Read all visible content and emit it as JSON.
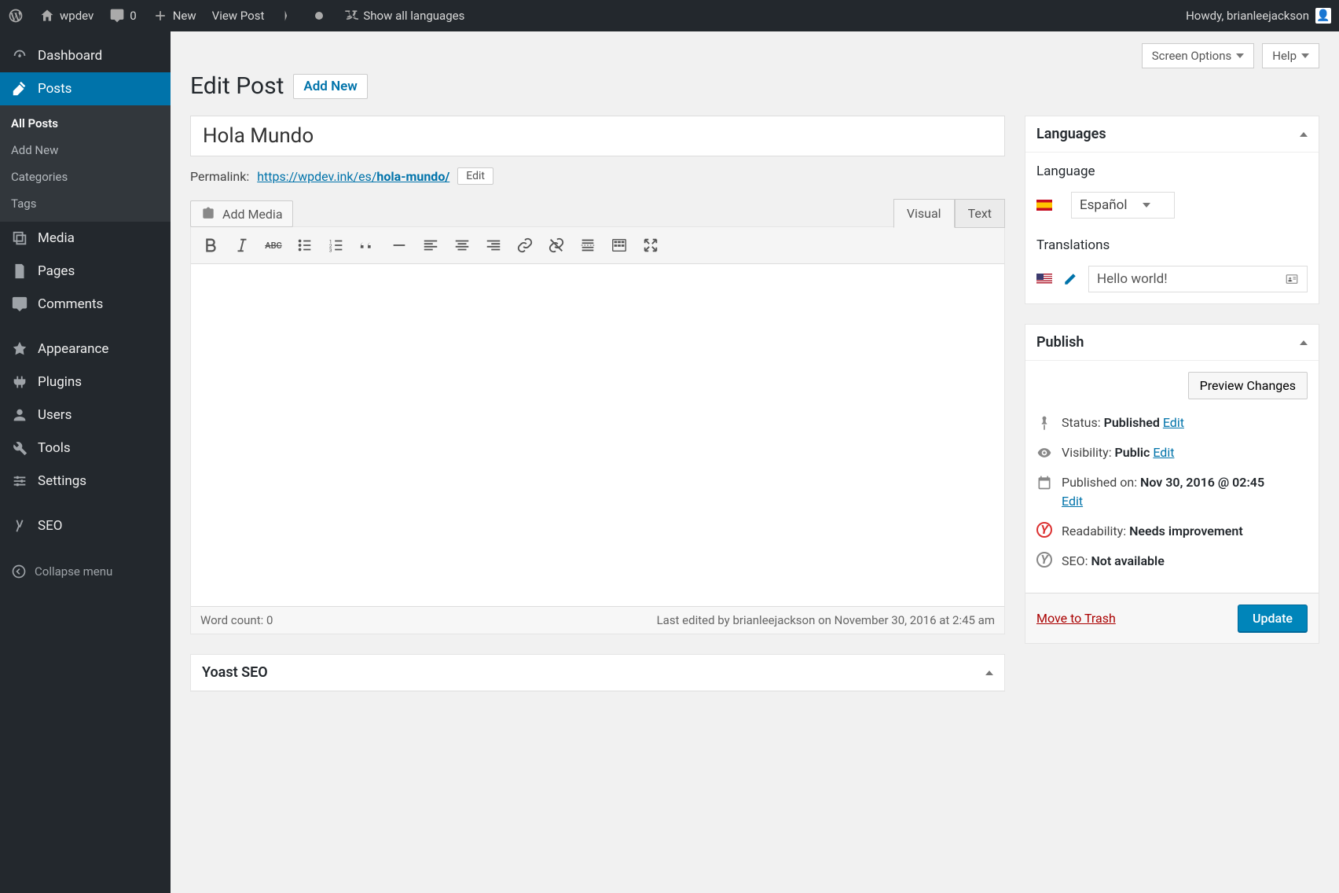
{
  "toolbar": {
    "site_name": "wpdev",
    "comments_count": "0",
    "new_label": "New",
    "view_post": "View Post",
    "show_languages": "Show all languages",
    "howdy": "Howdy, brianleejackson"
  },
  "sidebar": {
    "dashboard": "Dashboard",
    "posts": "Posts",
    "sub_all": "All Posts",
    "sub_add": "Add New",
    "sub_cat": "Categories",
    "sub_tags": "Tags",
    "media": "Media",
    "pages": "Pages",
    "comments": "Comments",
    "appearance": "Appearance",
    "plugins": "Plugins",
    "users": "Users",
    "tools": "Tools",
    "settings": "Settings",
    "seo": "SEO",
    "collapse": "Collapse menu"
  },
  "top": {
    "screen_options": "Screen Options",
    "help": "Help"
  },
  "page": {
    "title": "Edit Post",
    "add_new": "Add New"
  },
  "post": {
    "title": "Hola Mundo",
    "permalink_label": "Permalink:",
    "permalink_base": "https://wpdev.ink/es/",
    "permalink_slug": "hola-mundo/",
    "edit": "Edit",
    "add_media": "Add Media",
    "tab_visual": "Visual",
    "tab_text": "Text",
    "word_count": "Word count: 0",
    "last_edit": "Last edited by brianleejackson on November 30, 2016 at 2:45 am"
  },
  "yoast": {
    "title": "Yoast SEO"
  },
  "lang_box": {
    "title": "Languages",
    "label": "Language",
    "selected": "Español",
    "trans_label": "Translations",
    "trans_value": "Hello world!"
  },
  "publish": {
    "title": "Publish",
    "preview": "Preview Changes",
    "status_label": "Status:",
    "status_value": "Published",
    "visibility_label": "Visibility:",
    "visibility_value": "Public",
    "published_label": "Published on:",
    "published_value": "Nov 30, 2016 @ 02:45",
    "readability_label": "Readability:",
    "readability_value": "Needs improvement",
    "seo_label": "SEO:",
    "seo_value": "Not available",
    "edit": "Edit",
    "trash": "Move to Trash",
    "update": "Update"
  }
}
